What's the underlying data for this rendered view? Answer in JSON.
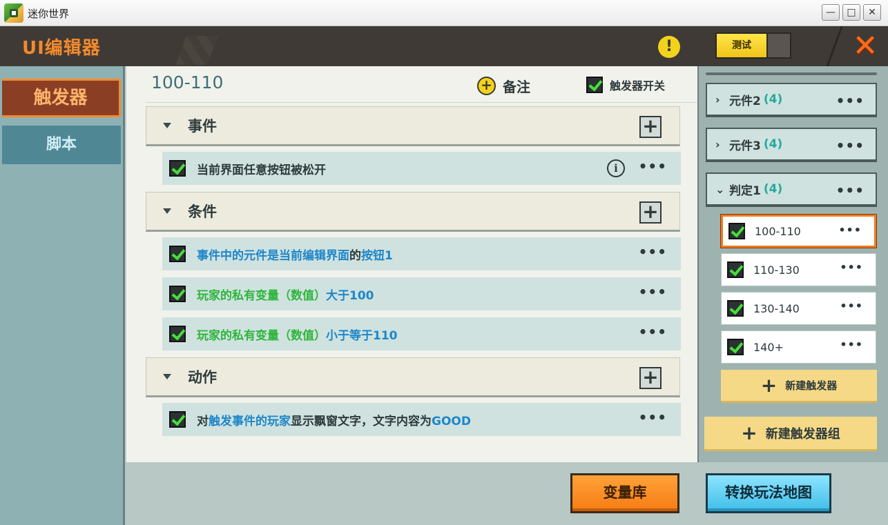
{
  "window": {
    "app_title": "迷你世界",
    "minimize": "—",
    "maximize": "□",
    "close": "✕"
  },
  "header": {
    "editor_title": "UI编辑器",
    "warning_glyph": "!",
    "test_label": "测试",
    "close_glyph": "✕"
  },
  "tabs": {
    "trigger": "触发器",
    "script": "脚本"
  },
  "main": {
    "trigger_name": "100-110",
    "notes_label": "备注",
    "switch_label": "触发器开关",
    "sections": {
      "event": {
        "title": "事件",
        "rows": [
          {
            "parts": [
              "当前界面任意按钮被松开"
            ]
          }
        ]
      },
      "condition": {
        "title": "条件",
        "rows": [
          {
            "parts": [
              "事件中的元件是当前编辑界面",
              "的",
              "按钮1"
            ]
          },
          {
            "parts": [
              "玩家的私有变量（数值）",
              "大于100"
            ]
          },
          {
            "parts": [
              "玩家的私有变量（数值）",
              "小于等于110"
            ]
          }
        ]
      },
      "action": {
        "title": "动作",
        "rows": [
          {
            "parts": [
              "对",
              "触发事件的玩家",
              "显示飘窗文字，文字内容为",
              "GOOD"
            ]
          }
        ]
      }
    },
    "more_glyph": "•••",
    "add_glyph": "+",
    "info_glyph": "i"
  },
  "right": {
    "groups": [
      {
        "label": "元件2",
        "count": "(4)",
        "chevron": "›"
      },
      {
        "label": "元件3",
        "count": "(4)",
        "chevron": "›"
      },
      {
        "label": "判定1",
        "count": "(4)",
        "chevron": "⌄"
      }
    ],
    "items": [
      "100-110",
      "110-130",
      "130-140",
      "140+"
    ],
    "selected_item": "100-110",
    "new_trigger": "新建触发器",
    "new_group": "新建触发器组"
  },
  "bottom": {
    "variable_library": "变量库",
    "convert_map": "转换玩法地图"
  },
  "colors": {
    "accent_orange": "#f48a2c",
    "text_blue": "#1f86c8",
    "text_green": "#2fb53c",
    "count_teal": "#27a89b"
  }
}
